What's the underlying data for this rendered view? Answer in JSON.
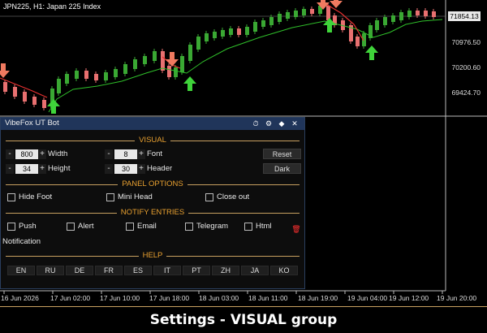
{
  "chart": {
    "title": "JPN225, H1:  Japan 225 Index",
    "current_price": "71854.13",
    "price_labels": [
      "70976.50",
      "70200.60",
      "69424.70"
    ],
    "time_labels": [
      "16 Jun 2026",
      "17 Jun 02:00",
      "17 Jun 10:00",
      "17 Jun 18:00",
      "18 Jun 03:00",
      "18 Jun 11:00",
      "18 Jun 19:00",
      "19 Jun 04:00",
      "19 Jun 12:00",
      "19 Jun 20:00"
    ],
    "colors": {
      "bull": "#3aa833",
      "bear": "#e87070",
      "signal_up": "#3fd43a",
      "signal_down": "#f07a60",
      "support": "#2fbf2a",
      "resistance": "#e83030"
    }
  },
  "panel": {
    "title": "VibeFox UT Bot",
    "titlebar_icons": [
      "clock-icon",
      "gear-icon",
      "diamond-icon",
      "close-icon"
    ],
    "titlebar_glyphs": [
      "⏱",
      "⚙",
      "◆",
      "✕"
    ],
    "sections": {
      "visual": "VISUAL",
      "panel_options": "PANEL OPTIONS",
      "notify": "NOTIFY ENTRIES",
      "help": "HELP"
    },
    "steppers": [
      {
        "label": "Width",
        "value": "800"
      },
      {
        "label": "Height",
        "value": "34"
      },
      {
        "label": "Font",
        "value": "8"
      },
      {
        "label": "Header",
        "value": "30"
      }
    ],
    "minus": "-",
    "plus": "+",
    "reset_label": "Reset",
    "dark_label": "Dark",
    "panel_checks": [
      "Hide Foot",
      "Mini Head",
      "Close out"
    ],
    "notify_checks": [
      "Push",
      "Alert",
      "Email",
      "Telegram",
      "Html"
    ],
    "notify_extra": "Notification",
    "trash_glyph": "🗑",
    "languages": [
      "EN",
      "RU",
      "DE",
      "FR",
      "ES",
      "IT",
      "PT",
      "ZH",
      "JA",
      "KO"
    ]
  },
  "caption": "Settings - VISUAL group"
}
